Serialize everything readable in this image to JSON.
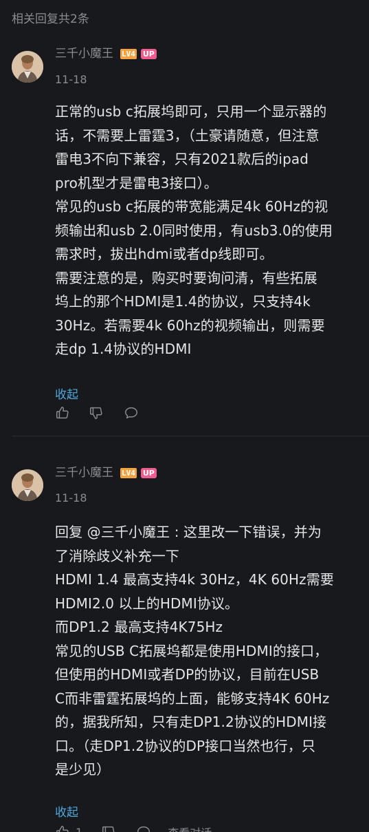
{
  "header": {
    "title": "相关回复共2条"
  },
  "comments": [
    {
      "username": "三千小魔王",
      "level": "LV4",
      "badge": "UP",
      "date": "11-18",
      "lines": [
        "正常的usb c拓展坞即可，只用一个显示器的",
        "话，不需要上雷霆3，（土豪请随意，但注意",
        "雷电3不向下兼容，只有2021款后的ipad",
        "pro机型才是雷电3接口）。",
        "常见的usb c拓展的带宽能满足4k 60Hz的视",
        "频输出和usb 2.0同时使用，有usb3.0的使用",
        "需求时，拔出hdmi或者dp线即可。",
        "需要注意的是，购买时要询问清，有些拓展",
        "坞上的那个HDMI是1.4的协议，只支持4k",
        "30Hz。若需要4k 60hz的视频输出，则需要",
        "走dp 1.4协议的HDMI"
      ],
      "collapse_label": "收起"
    },
    {
      "username": "三千小魔王",
      "level": "LV4",
      "badge": "UP",
      "date": "11-18",
      "lines": [
        "回复 @三千小魔王 : 这里改一下错误，并为",
        "了消除歧义补充一下",
        "HDMI 1.4 最高支持4k 30Hz，4K 60Hz需要",
        "HDMI2.0 以上的HDMI协议。",
        "而DP1.2 最高支持4K75Hz",
        "常见的USB C拓展坞都是使用HDMI的接口，",
        "但使用的HDMI或者DP的协议，目前在USB",
        "C而非雷霆拓展坞的上面，能够支持4K 60Hz",
        "的，据我所知，只有走DP1.2协议的HDMI接",
        "口。（走DP1.2协议的DP接口当然也行，只",
        "是少见）"
      ],
      "collapse_label": "收起",
      "like_count": "1",
      "view_dialog_label": "查看对话"
    }
  ],
  "icons": [
    "like-icon",
    "dislike-icon",
    "reply-icon"
  ],
  "colors": {
    "background": "#18191c",
    "link": "#4ea8de",
    "level_badge": "#f4a340",
    "up_badge": "#f05d8c"
  }
}
